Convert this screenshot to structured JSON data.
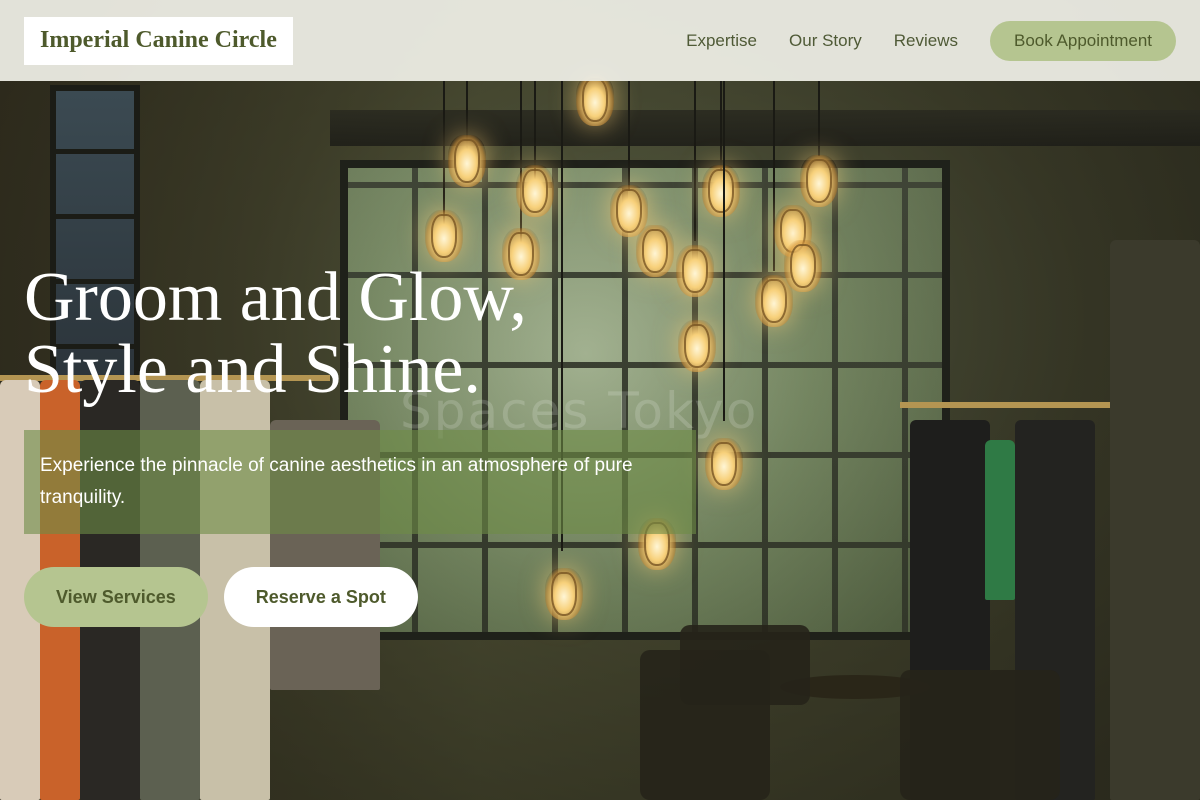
{
  "brand": {
    "name": "Imperial Canine Circle"
  },
  "nav": {
    "links": [
      {
        "label": "Expertise"
      },
      {
        "label": "Our Story"
      },
      {
        "label": "Reviews"
      }
    ],
    "cta_label": "Book Appointment"
  },
  "hero": {
    "title_line1": "Groom and Glow,",
    "title_line2": "Style and Shine.",
    "subtitle": "Experience the pinnacle of canine aesthetics in an atmosphere of pure tranquility.",
    "primary_cta": "View Services",
    "secondary_cta": "Reserve a Spot",
    "background_watermark": "Spaces Tokyo"
  },
  "colors": {
    "accent": "#b5c590",
    "brand_text": "#4e5a2c",
    "nav_background": "#eeeee6",
    "subtitle_overlay": "#6e8c46"
  }
}
